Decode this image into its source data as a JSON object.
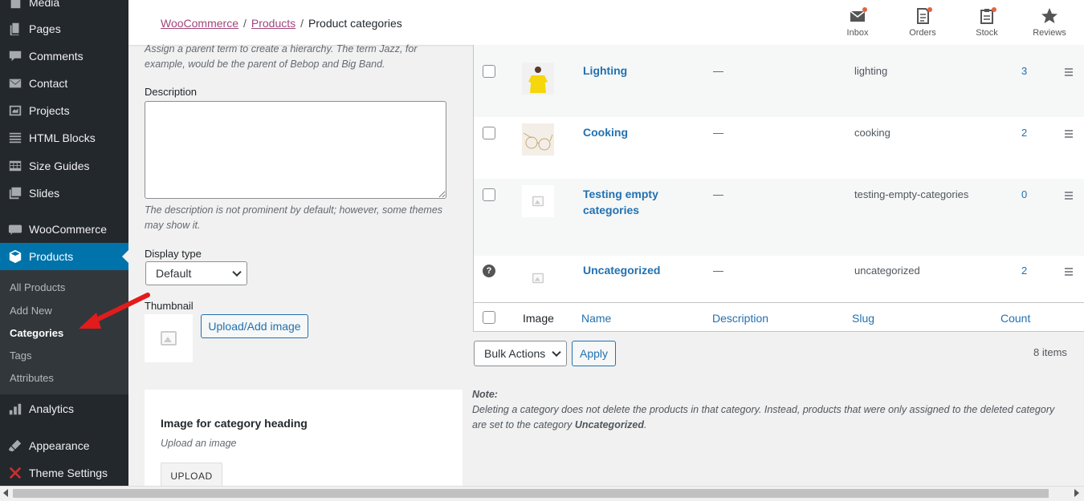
{
  "sidebar": {
    "items": [
      {
        "label": "Media",
        "icon": "media-icon"
      },
      {
        "label": "Pages",
        "icon": "pages-icon"
      },
      {
        "label": "Comments",
        "icon": "comments-icon"
      },
      {
        "label": "Contact",
        "icon": "mail-icon"
      },
      {
        "label": "Projects",
        "icon": "portfolio-icon"
      },
      {
        "label": "HTML Blocks",
        "icon": "blocks-icon"
      },
      {
        "label": "Size Guides",
        "icon": "table-icon"
      },
      {
        "label": "Slides",
        "icon": "slides-icon"
      },
      {
        "label": "WooCommerce",
        "icon": "woocommerce-icon"
      },
      {
        "label": "Products",
        "icon": "products-icon"
      },
      {
        "label": "Analytics",
        "icon": "chart-icon"
      },
      {
        "label": "Appearance",
        "icon": "brush-icon"
      },
      {
        "label": "Theme Settings",
        "icon": "settings-icon"
      }
    ],
    "submenu": [
      "All Products",
      "Add New",
      "Categories",
      "Tags",
      "Attributes"
    ]
  },
  "topbar": {
    "breadcrumb": [
      "WooCommerce",
      "Products",
      "Product categories"
    ],
    "separator": "/",
    "actions": [
      {
        "label": "Inbox",
        "icon": "inbox-icon"
      },
      {
        "label": "Orders",
        "icon": "orders-icon"
      },
      {
        "label": "Stock",
        "icon": "stock-icon"
      },
      {
        "label": "Reviews",
        "icon": "star-icon"
      }
    ]
  },
  "form": {
    "parent_help": "Assign a parent term to create a hierarchy. The term Jazz, for example, would be the parent of Bebop and Big Band.",
    "description_label": "Description",
    "description_value": "",
    "description_help": "The description is not prominent by default; however, some themes may show it.",
    "display_type_label": "Display type",
    "display_type_value": "Default",
    "thumbnail_label": "Thumbnail",
    "upload_button": "Upload/Add image",
    "heading_panel": {
      "title": "Image for category heading",
      "subtitle": "Upload an image",
      "button": "UPLOAD"
    }
  },
  "table": {
    "rows": [
      {
        "name": "Lighting",
        "description": "—",
        "slug": "lighting",
        "count": "3"
      },
      {
        "name": "Cooking",
        "description": "—",
        "slug": "cooking",
        "count": "2"
      },
      {
        "name": "Testing empty categories",
        "description": "—",
        "slug": "testing-empty-categories",
        "count": "0"
      },
      {
        "name": "Uncategorized",
        "description": "—",
        "slug": "uncategorized",
        "count": "2"
      }
    ],
    "columns": {
      "image": "Image",
      "name": "Name",
      "description": "Description",
      "slug": "Slug",
      "count": "Count"
    },
    "bulk_actions": "Bulk Actions",
    "apply": "Apply",
    "items_count": "8 items",
    "default_help_icon": "?"
  },
  "note": {
    "label": "Note:",
    "text": "Deleting a category does not delete the products in that category. Instead, products that were only assigned to the deleted category are set to the category",
    "emphasis": "Uncategorized",
    "end": "."
  },
  "colors": {
    "sidebar": "#23282d",
    "accent": "#0073aa",
    "link": "#2271b1",
    "woo": "#a0467b",
    "arrow": "#e21b1b"
  }
}
